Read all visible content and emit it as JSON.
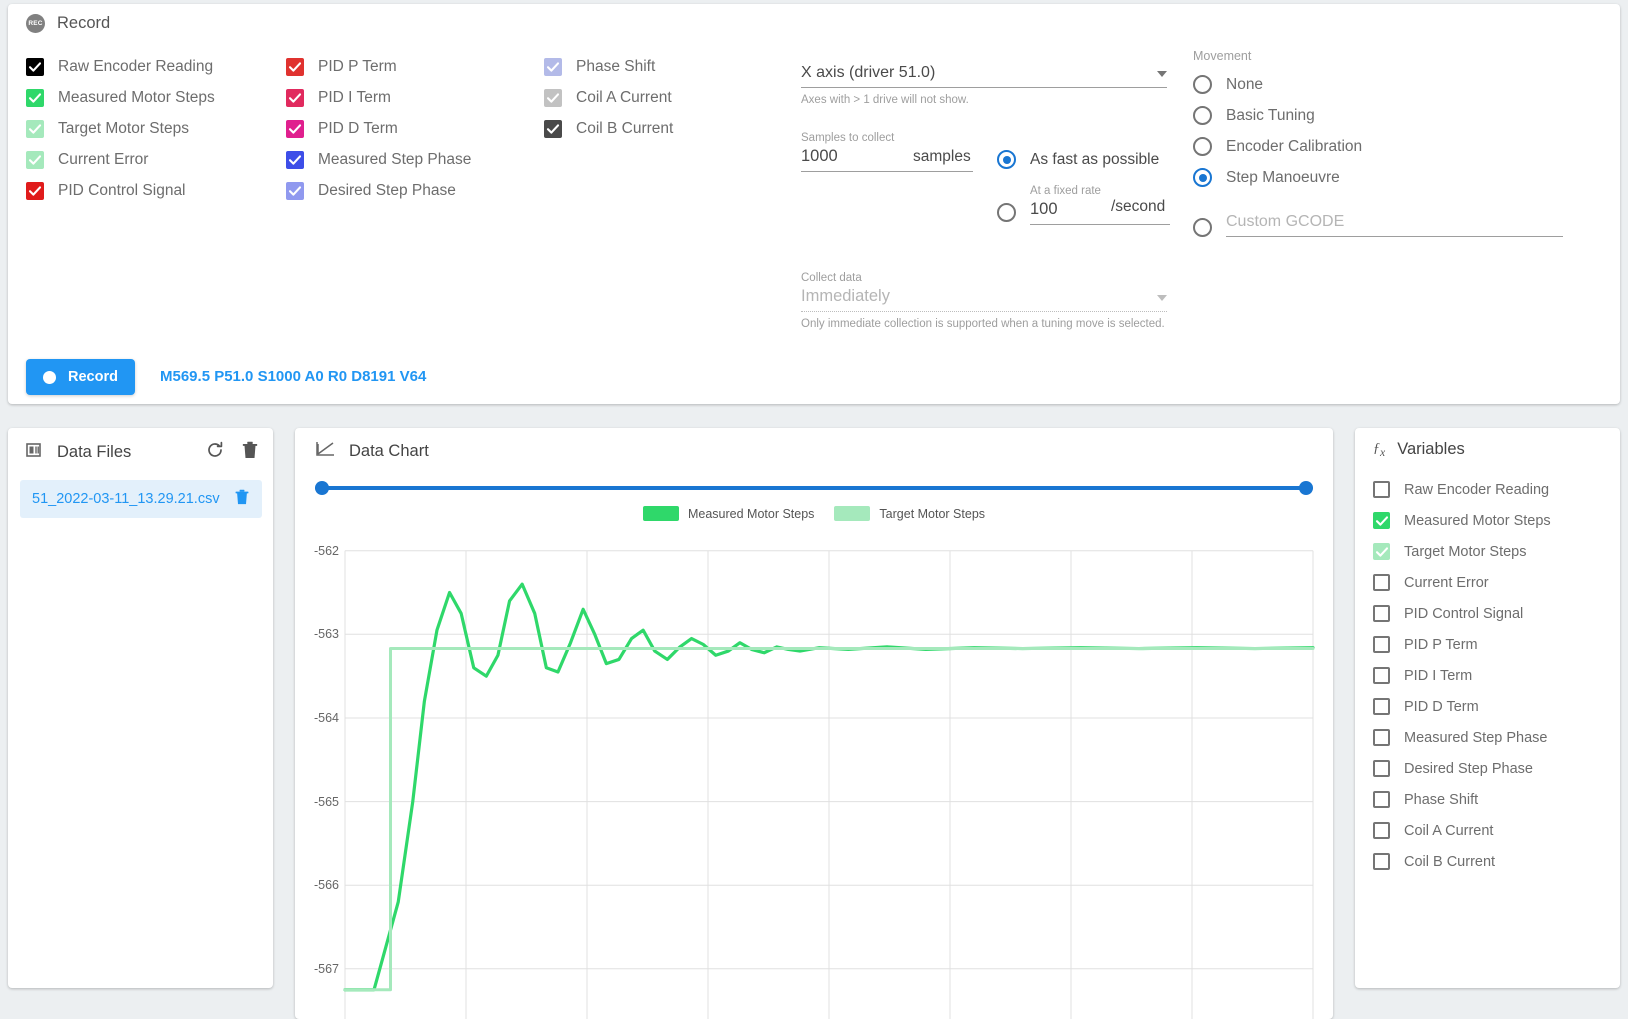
{
  "record_card": {
    "title": "Record",
    "icon": "record-icon",
    "checkbox_columns": [
      [
        {
          "label": "Raw Encoder Reading",
          "checked": true,
          "color": "#000000",
          "disabled": false
        },
        {
          "label": "Measured Motor Steps",
          "checked": true,
          "color": "#2fd86a",
          "disabled": false
        },
        {
          "label": "Target Motor Steps",
          "checked": true,
          "color": "#a5e9bc",
          "disabled": true
        },
        {
          "label": "Current Error",
          "checked": true,
          "color": "#a5e9bc",
          "disabled": true
        },
        {
          "label": "PID Control Signal",
          "checked": true,
          "color": "#e01b1b",
          "disabled": false
        }
      ],
      [
        {
          "label": "PID P Term",
          "checked": true,
          "color": "#e0322f",
          "disabled": false
        },
        {
          "label": "PID I Term",
          "checked": true,
          "color": "#e12a5e",
          "disabled": false
        },
        {
          "label": "PID D Term",
          "checked": true,
          "color": "#e01f8e",
          "disabled": false
        },
        {
          "label": "Measured Step Phase",
          "checked": true,
          "color": "#3d4ee8",
          "disabled": false
        },
        {
          "label": "Desired Step Phase",
          "checked": true,
          "color": "#9099ef",
          "disabled": true
        }
      ],
      [
        {
          "label": "Phase Shift",
          "checked": true,
          "color": "#b3bae8",
          "disabled": true
        },
        {
          "label": "Coil A Current",
          "checked": true,
          "color": "#c2c2c2",
          "disabled": true
        },
        {
          "label": "Coil B Current",
          "checked": true,
          "color": "#4a4a4a",
          "disabled": false
        }
      ]
    ],
    "axis_select": {
      "value": "X axis (driver 51.0)",
      "hint": "Axes with > 1 drive will not show."
    },
    "samples": {
      "label": "Samples to collect",
      "value": "1000",
      "unit": "samples"
    },
    "rate": {
      "as_fast_label": "As fast as possible",
      "as_fast_selected": true,
      "fixed_rate_label": "At a fixed rate",
      "fixed_rate_value": "100",
      "fixed_rate_unit": "/second",
      "fixed_selected": false
    },
    "collect": {
      "label": "Collect data",
      "value": "Immediately",
      "hint": "Only immediate collection is supported when a tuning move is selected."
    },
    "movement": {
      "title": "Movement",
      "options": [
        {
          "label": "None",
          "selected": false
        },
        {
          "label": "Basic Tuning",
          "selected": false
        },
        {
          "label": "Encoder Calibration",
          "selected": false
        },
        {
          "label": "Step Manoeuvre",
          "selected": true
        }
      ],
      "custom": {
        "label": "Custom GCODE",
        "selected": false,
        "placeholder": ""
      }
    },
    "record_button": "Record",
    "gcode_preview": "M569.5 P51.0 S1000 A0 R0 D8191 V64",
    "accent_color": "#2196f3"
  },
  "data_files": {
    "title": "Data Files",
    "panel_icon": "files-icon",
    "refresh_icon": "refresh-icon",
    "delete_all_icon": "trash-icon",
    "items": [
      {
        "name": "51_2022-03-11_13.29.21.csv",
        "selected": true,
        "delete_icon": "trash-icon"
      }
    ]
  },
  "chart_card": {
    "title": "Data Chart",
    "panel_icon": "chart-icon",
    "slider": {
      "left_value": 0,
      "right_value": 100
    }
  },
  "variables": {
    "title": "Variables",
    "icon": "fx-icon",
    "items": [
      {
        "label": "Raw Encoder Reading",
        "checked": false,
        "color": "#000000",
        "disabled": false
      },
      {
        "label": "Measured Motor Steps",
        "checked": true,
        "color": "#2fd86a",
        "disabled": false
      },
      {
        "label": "Target Motor Steps",
        "checked": true,
        "color": "#a5e9bc",
        "disabled": true
      },
      {
        "label": "Current Error",
        "checked": false,
        "color": "#000000",
        "disabled": false
      },
      {
        "label": "PID Control Signal",
        "checked": false,
        "color": "#000000",
        "disabled": false
      },
      {
        "label": "PID P Term",
        "checked": false,
        "color": "#000000",
        "disabled": false
      },
      {
        "label": "PID I Term",
        "checked": false,
        "color": "#000000",
        "disabled": false
      },
      {
        "label": "PID D Term",
        "checked": false,
        "color": "#000000",
        "disabled": false
      },
      {
        "label": "Measured Step Phase",
        "checked": false,
        "color": "#000000",
        "disabled": false
      },
      {
        "label": "Desired Step Phase",
        "checked": false,
        "color": "#000000",
        "disabled": false
      },
      {
        "label": "Phase Shift",
        "checked": false,
        "color": "#000000",
        "disabled": false
      },
      {
        "label": "Coil A Current",
        "checked": false,
        "color": "#000000",
        "disabled": false
      },
      {
        "label": "Coil B Current",
        "checked": false,
        "color": "#000000",
        "disabled": false
      }
    ]
  },
  "chart_data": {
    "type": "line",
    "title": "Data Chart",
    "xlabel": "",
    "ylabel": "",
    "grid": true,
    "legend_position": "top-center",
    "ylim": [
      -567.6,
      -561.8
    ],
    "yticks": [
      -562,
      -563,
      -564,
      -565,
      -566,
      -567
    ],
    "xlim": [
      0,
      1000
    ],
    "x_gridlines": [
      0,
      125,
      250,
      375,
      500,
      625,
      750,
      875,
      1000
    ],
    "series": [
      {
        "name": "Measured Motor Steps",
        "color": "#2fd86a",
        "x": [
          0,
          30,
          55,
          70,
          82,
          95,
          108,
          120,
          133,
          146,
          158,
          170,
          183,
          196,
          208,
          220,
          233,
          246,
          258,
          270,
          283,
          296,
          308,
          320,
          333,
          346,
          358,
          370,
          383,
          396,
          408,
          420,
          433,
          446,
          458,
          470,
          490,
          520,
          560,
          600,
          650,
          700,
          760,
          820,
          880,
          940,
          1000
        ],
        "y": [
          -567.25,
          -567.25,
          -566.2,
          -565.0,
          -563.8,
          -562.95,
          -562.5,
          -562.75,
          -563.4,
          -563.5,
          -563.25,
          -562.6,
          -562.4,
          -562.75,
          -563.4,
          -563.45,
          -563.1,
          -562.7,
          -563.0,
          -563.35,
          -563.3,
          -563.05,
          -562.95,
          -563.2,
          -563.3,
          -563.15,
          -563.05,
          -563.12,
          -563.25,
          -563.2,
          -563.1,
          -563.18,
          -563.22,
          -563.15,
          -563.18,
          -563.2,
          -563.16,
          -563.18,
          -563.15,
          -563.18,
          -563.16,
          -563.17,
          -563.16,
          -563.17,
          -563.16,
          -563.17,
          -563.16
        ]
      },
      {
        "name": "Target Motor Steps",
        "color": "#a5e9bc",
        "x": [
          0,
          47,
          47,
          1000
        ],
        "y": [
          -567.25,
          -567.25,
          -563.17,
          -563.17
        ]
      }
    ]
  }
}
